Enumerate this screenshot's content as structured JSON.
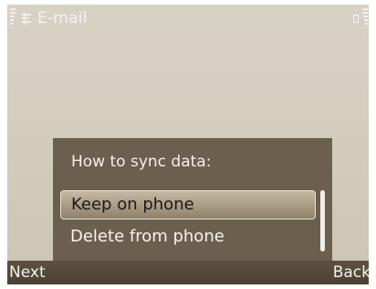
{
  "status_bar": {
    "app_title": "E-mail",
    "app_icon": "email-app-icon",
    "battery_icon": "battery-icon",
    "signal_icon": "signal-strength-icon"
  },
  "dialog": {
    "title": "How to sync data:",
    "options": [
      {
        "label": "Keep on phone",
        "selected": true
      },
      {
        "label": "Delete from phone",
        "selected": false
      }
    ]
  },
  "softkeys": {
    "left": "Next",
    "right": "Back"
  },
  "colors": {
    "background": "#d3cdbe",
    "dialog": "#6b5f4d",
    "highlight": "#a99b83",
    "softkey_bar": "#4b4133",
    "text_light": "#f5f2ec"
  }
}
